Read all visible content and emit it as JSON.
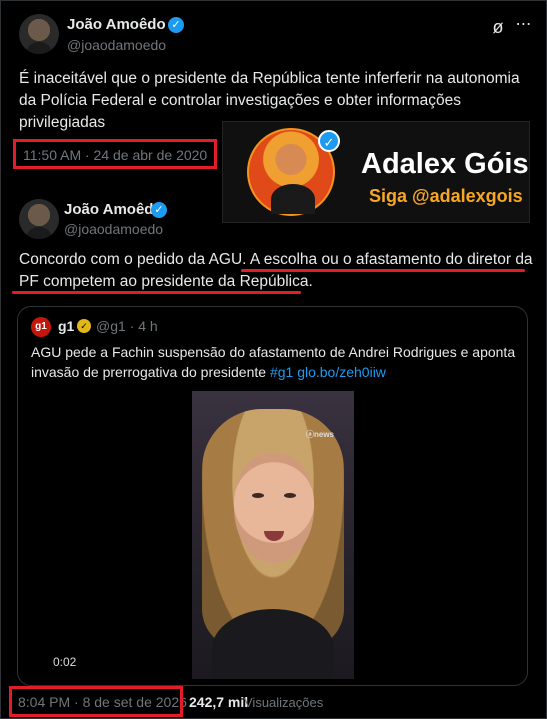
{
  "main_tweet": {
    "author_name": "João Amoêdo",
    "author_handle": "@joaodamoedo",
    "text": "Concordo com o pedido da AGU. A escolha ou o afastamento do diretor da PF competem ao presidente da República.",
    "text_line1_plain": "Concordo com o pedido da AGU. ",
    "text_line1_underlined": "A escolha ou o afastamento do diretor da",
    "text_line2_underlined": "PF competem ao presidente da República",
    "text_line2_end": ".",
    "timestamp": "8:04 PM · 8 de set de 2026",
    "views_count": "242,7 mil",
    "views_label": "Visualizações"
  },
  "older_tweet": {
    "author_name": "João Amoêdo",
    "author_handle": "@joaodamoedo",
    "text_line1": "É inaceitável que o presidente da República tente inferferir na autonomia",
    "text_line2": "da Polícia Federal e controlar investigações e obter informações",
    "text_line3": "privilegiadas",
    "timestamp": "11:50 AM · 24 de abr de 2020"
  },
  "icons": {
    "grok": "grok-icon",
    "more": "more-icon",
    "verified": "verified-badge-icon"
  },
  "ad_banner": {
    "title": "Adalex Góis",
    "subtitle": "Siga @adalexgois"
  },
  "quoted_tweet": {
    "source_logo": "g1",
    "source_name": "g1",
    "source_handle_time": "@g1 · 4 h",
    "text_line1": "AGU pede a Fachin suspensão do afastamento de Andrei Rodrigues e aponta",
    "text_line2_plain": "invasão de prerrogativa do presidente ",
    "text_line2_hashtag": "#g1",
    "text_line2_link": "glo.bo/zeh0iiw",
    "video_overlay": "ⓐnews",
    "video_duration": "0:02"
  },
  "colors": {
    "background": "#000000",
    "text": "#e7e9ea",
    "secondary": "#71767b",
    "verified": "#1d9bf0",
    "annotation_red": "#e11d2a",
    "ad_accent": "#f7a823"
  }
}
